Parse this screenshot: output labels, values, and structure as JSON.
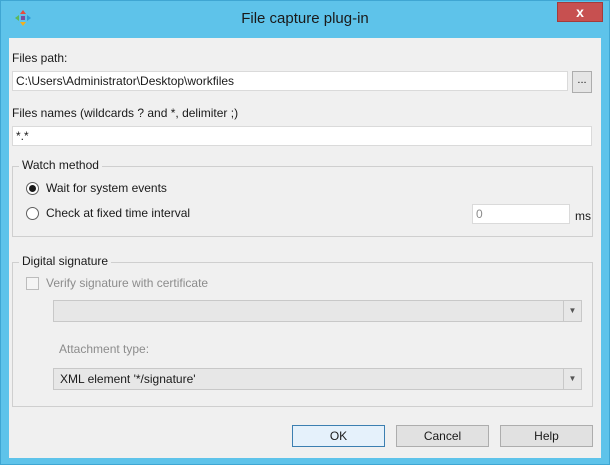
{
  "window": {
    "title": "File capture plug-in",
    "close_glyph": "x",
    "app_icon": "plugin-colored-arrows-icon"
  },
  "files_path": {
    "label": "Files path:",
    "value": "C:\\Users\\Administrator\\Desktop\\workfiles",
    "browse_label": "..."
  },
  "files_names": {
    "label": "Files names (wildcards ? and *, delimiter ;)",
    "value": "*.*"
  },
  "watch_method": {
    "title": "Watch method",
    "option_system_events": "Wait for system events",
    "option_fixed_interval": "Check at fixed time interval",
    "selected": "system_events",
    "interval_value": "0",
    "interval_unit": "ms"
  },
  "digital_signature": {
    "title": "Digital signature",
    "verify_label": "Verify signature with certificate",
    "verify_checked": false,
    "certificate_value": "",
    "attachment_type_label": "Attachment type:",
    "attachment_type_value": "XML element '*/signature'"
  },
  "buttons": {
    "ok": "OK",
    "cancel": "Cancel",
    "help": "Help"
  },
  "colors": {
    "title_bar": "#5ec3ea",
    "close_button": "#c75050",
    "dialog_bg": "#f0f0f0",
    "default_button_border": "#3c7fb1"
  }
}
